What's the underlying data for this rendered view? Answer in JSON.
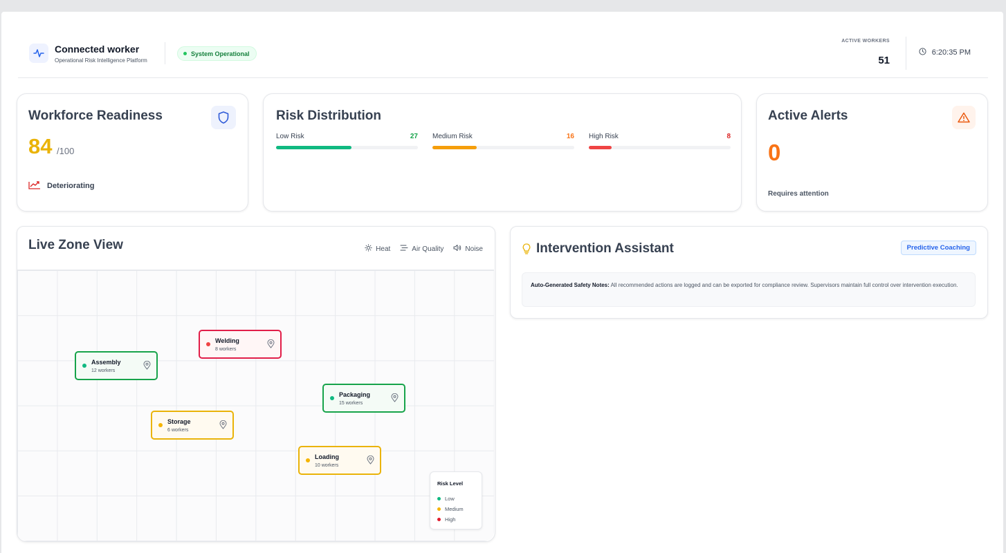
{
  "header": {
    "app_title": "Connected worker",
    "app_subtitle": "Operational Risk Intelligence Platform",
    "status": "System Operational",
    "active_workers_label": "ACTIVE WORKERS",
    "active_workers_count": "51",
    "time": "6:20:35 PM",
    "icons": {
      "brand": "activity-icon",
      "clock": "clock-icon"
    }
  },
  "readiness": {
    "title": "Workforce Readiness",
    "score": "84",
    "score_max": "/100",
    "trend": "Deteriorating",
    "icons": {
      "badge": "shield-icon",
      "trend": "trending-icon"
    },
    "colors": {
      "score": "#eab308",
      "trend": "#dc2626"
    }
  },
  "risk_distribution": {
    "title": "Risk Distribution",
    "items": [
      {
        "label": "Low Risk",
        "count": "27",
        "share": 0.53,
        "color": "#10b981"
      },
      {
        "label": "Medium Risk",
        "count": "16",
        "share": 0.31,
        "color": "#f59e0b"
      },
      {
        "label": "High Risk",
        "count": "8",
        "share": 0.16,
        "color": "#ef4444"
      }
    ]
  },
  "alerts": {
    "title": "Active Alerts",
    "count": "0",
    "note": "Requires attention",
    "icons": {
      "badge": "warning-icon"
    },
    "colors": {
      "count": "#f97316"
    }
  },
  "zone_view": {
    "title": "Live Zone View",
    "filters": [
      {
        "label": "Heat",
        "icon": "sun-icon"
      },
      {
        "label": "Air Quality",
        "icon": "wind-icon"
      },
      {
        "label": "Noise",
        "icon": "volume-icon"
      }
    ],
    "zones": [
      {
        "name": "Welding",
        "workers": "8 workers",
        "level": "high"
      },
      {
        "name": "Assembly",
        "workers": "12 workers",
        "level": "low"
      },
      {
        "name": "Packaging",
        "workers": "15 workers",
        "level": "low"
      },
      {
        "name": "Storage",
        "workers": "6 workers",
        "level": "medium"
      },
      {
        "name": "Loading",
        "workers": "10 workers",
        "level": "medium"
      }
    ],
    "legend": {
      "title": "Risk Level",
      "items": [
        {
          "label": "Low",
          "color": "#10b981"
        },
        {
          "label": "Medium",
          "color": "#f5b400"
        },
        {
          "label": "High",
          "color": "#e11d2e"
        }
      ]
    }
  },
  "intervention": {
    "title": "Intervention Assistant",
    "badge": "Predictive Coaching",
    "note_label": "Auto-Generated Safety Notes:",
    "note_text": " All recommended actions are logged and can be exported for compliance review. Supervisors maintain full control over intervention execution.",
    "icons": {
      "title": "lightbulb-icon"
    }
  }
}
